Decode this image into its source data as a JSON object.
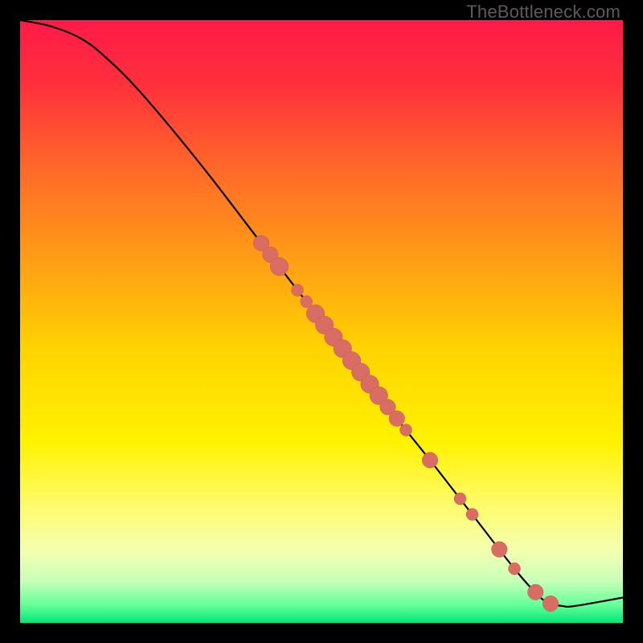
{
  "watermark": "TheBottleneck.com",
  "colors": {
    "curve": "#000000",
    "marker_fill": "#d96d63",
    "marker_stroke": "#c45a50",
    "black": "#000000"
  },
  "chart_data": {
    "type": "line",
    "title": "",
    "xlabel": "",
    "ylabel": "",
    "xlim": [
      0,
      100
    ],
    "ylim": [
      0,
      100
    ],
    "grid": false,
    "legend": false,
    "series": [
      {
        "name": "curve",
        "x": [
          0,
          5,
          10,
          14,
          20,
          30,
          40,
          50,
          60,
          68,
          75,
          82,
          86,
          88,
          90,
          92,
          100
        ],
        "y": [
          100,
          99,
          97,
          94,
          88,
          76,
          63,
          50,
          37,
          27,
          18,
          9,
          4.5,
          3.2,
          2.8,
          2.8,
          4.2
        ]
      }
    ],
    "markers": {
      "name": "scatter-points",
      "style": "circle",
      "points": [
        {
          "x": 40.0,
          "y": 63.0,
          "r": 1.3
        },
        {
          "x": 41.5,
          "y": 61.1,
          "r": 1.3
        },
        {
          "x": 43.0,
          "y": 59.1,
          "r": 1.5
        },
        {
          "x": 46.0,
          "y": 55.2,
          "r": 1.0
        },
        {
          "x": 47.5,
          "y": 53.3,
          "r": 1.0
        },
        {
          "x": 49.0,
          "y": 51.3,
          "r": 1.5
        },
        {
          "x": 50.5,
          "y": 49.4,
          "r": 1.5
        },
        {
          "x": 52.0,
          "y": 47.4,
          "r": 1.5
        },
        {
          "x": 53.5,
          "y": 45.5,
          "r": 1.5
        },
        {
          "x": 55.0,
          "y": 43.5,
          "r": 1.5
        },
        {
          "x": 56.5,
          "y": 41.6,
          "r": 1.5
        },
        {
          "x": 58.0,
          "y": 39.6,
          "r": 1.5
        },
        {
          "x": 59.5,
          "y": 37.7,
          "r": 1.5
        },
        {
          "x": 61.0,
          "y": 35.8,
          "r": 1.3
        },
        {
          "x": 62.5,
          "y": 33.9,
          "r": 1.3
        },
        {
          "x": 64.0,
          "y": 32.0,
          "r": 1.0
        },
        {
          "x": 68.0,
          "y": 27.0,
          "r": 1.3
        },
        {
          "x": 73.0,
          "y": 20.6,
          "r": 1.0
        },
        {
          "x": 75.0,
          "y": 18.0,
          "r": 1.0
        },
        {
          "x": 79.5,
          "y": 12.2,
          "r": 1.3
        },
        {
          "x": 82.0,
          "y": 9.0,
          "r": 1.0
        },
        {
          "x": 85.5,
          "y": 5.1,
          "r": 1.3
        },
        {
          "x": 88.0,
          "y": 3.2,
          "r": 1.3
        }
      ]
    },
    "background_gradient": {
      "direction": "vertical",
      "stops": [
        {
          "t": 0.0,
          "color": "#ff1a47"
        },
        {
          "t": 0.1,
          "color": "#ff2e3d"
        },
        {
          "t": 0.25,
          "color": "#ff6a28"
        },
        {
          "t": 0.4,
          "color": "#ff9e15"
        },
        {
          "t": 0.55,
          "color": "#ffd400"
        },
        {
          "t": 0.7,
          "color": "#fff200"
        },
        {
          "t": 0.8,
          "color": "#fffb66"
        },
        {
          "t": 0.88,
          "color": "#f4ffb0"
        },
        {
          "t": 0.93,
          "color": "#c9ffb8"
        },
        {
          "t": 0.97,
          "color": "#66ff99"
        },
        {
          "t": 1.0,
          "color": "#00e676"
        }
      ]
    }
  }
}
